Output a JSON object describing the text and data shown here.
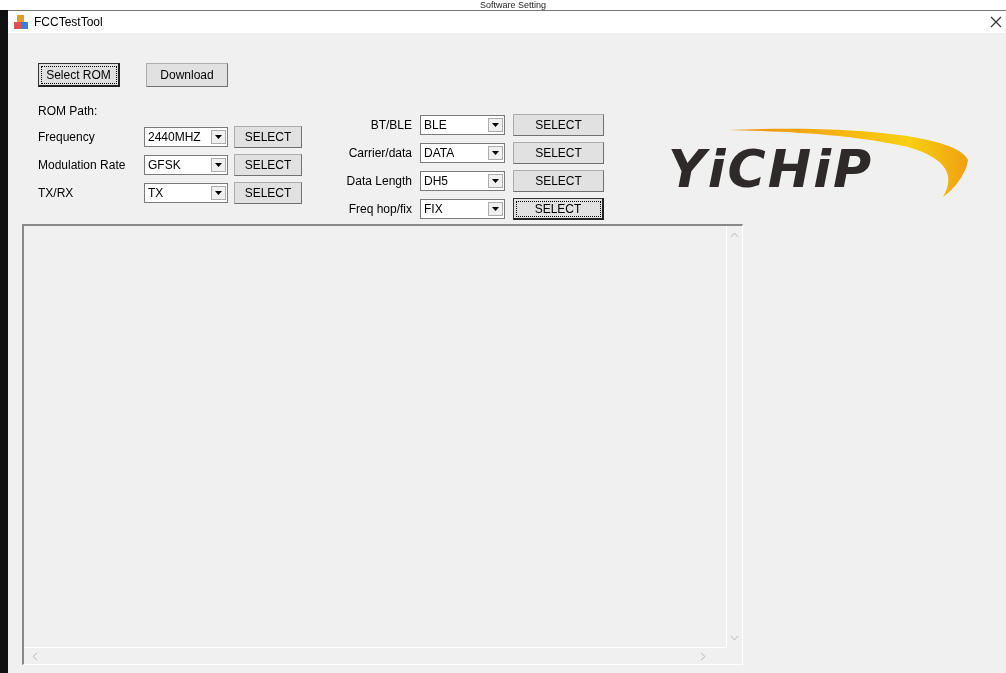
{
  "page_heading": "Software Setting",
  "window": {
    "title": "FCCTestTool"
  },
  "top_buttons": [
    {
      "label": "Select ROM",
      "focused": true
    },
    {
      "label": "Download",
      "focused": false
    }
  ],
  "rom_path_label": "ROM Path:",
  "left_settings": [
    {
      "label": "Frequency",
      "value": "2440MHZ",
      "button": "SELECT",
      "focused": false
    },
    {
      "label": "Modulation Rate",
      "value": "GFSK",
      "button": "SELECT",
      "focused": false
    },
    {
      "label": "TX/RX",
      "value": "TX",
      "button": "SELECT",
      "focused": false
    }
  ],
  "right_settings": [
    {
      "label": "BT/BLE",
      "value": "BLE",
      "button": "SELECT",
      "focused": false
    },
    {
      "label": "Carrier/data",
      "value": "DATA",
      "button": "SELECT",
      "focused": false
    },
    {
      "label": "Data Length",
      "value": "DH5",
      "button": "SELECT",
      "focused": false
    },
    {
      "label": "Freq hop/fix",
      "value": "FIX",
      "button": "SELECT",
      "focused": true
    }
  ],
  "logo": {
    "text": "YiCHiP"
  }
}
